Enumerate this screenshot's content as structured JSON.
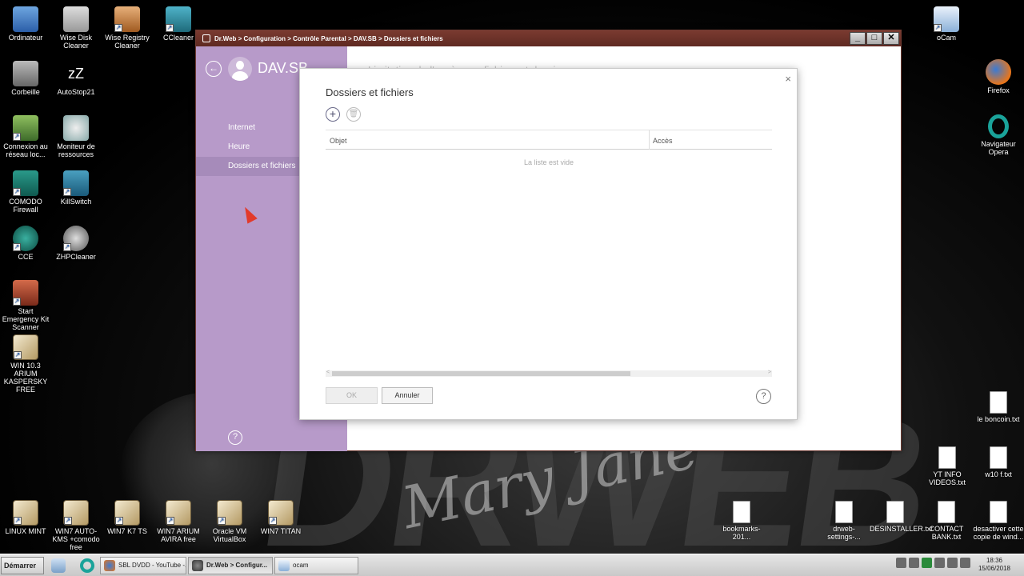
{
  "window": {
    "title": "Dr.Web > Configuration > Contrôle Parental > DAV.SB > Dossiers et fichiers",
    "minimize": "_",
    "maximize": "□",
    "close": "✕"
  },
  "sidebar": {
    "back": "←",
    "user": "DAV.SB",
    "items": [
      {
        "label": "Internet"
      },
      {
        "label": "Heure"
      },
      {
        "label": "Dossiers et fichiers"
      }
    ],
    "help": "?"
  },
  "main": {
    "heading": "Limitation de l'accès aux fichiers et dossiers"
  },
  "dialog": {
    "title": "Dossiers et fichiers",
    "close": "×",
    "add": "+",
    "delete": "🗑",
    "columns": {
      "object": "Objet",
      "access": "Accès"
    },
    "empty_text": "La liste est vide",
    "scroll_left": "<",
    "scroll_right": ">",
    "ok": "OK",
    "cancel": "Annuler",
    "help": "?"
  },
  "desktop_icons_left": [
    {
      "label": "Ordinateur",
      "icon": "computer-icon"
    },
    {
      "label": "Wise Disk Cleaner",
      "icon": "broom-icon"
    },
    {
      "label": "Wise Registry Cleaner",
      "icon": "registry-icon"
    },
    {
      "label": "CCleaner",
      "icon": "ccleaner-icon"
    },
    {
      "label": "Corbeille",
      "icon": "trash-icon"
    },
    {
      "label": "AutoStop21",
      "icon": "sleep-icon"
    },
    {
      "label": "Connexion au réseau loc...",
      "icon": "network-icon"
    },
    {
      "label": "Moniteur de ressources",
      "icon": "gauge-icon"
    },
    {
      "label": "COMODO Firewall",
      "icon": "comodo-icon"
    },
    {
      "label": "KillSwitch",
      "icon": "killswitch-icon"
    },
    {
      "label": "CCE",
      "icon": "cce-icon"
    },
    {
      "label": "ZHPCleaner",
      "icon": "zhp-icon"
    },
    {
      "label": "Start Emergency Kit Scanner",
      "icon": "scanner-icon"
    },
    {
      "label": "WIN 10.3 ARIUM KASPERSKY FREE",
      "icon": "vm-box-icon"
    }
  ],
  "desktop_icons_bottom": [
    {
      "label": "LINUX MINT"
    },
    {
      "label": "WIN7 AUTO-KMS +comodo free"
    },
    {
      "label": "WIN7 K7 TS"
    },
    {
      "label": "WIN7 ARIUM AVIRA free"
    },
    {
      "label": "Oracle VM VirtualBox"
    },
    {
      "label": "WIN7 TITAN"
    }
  ],
  "desktop_icons_right": [
    {
      "label": "oCam"
    },
    {
      "label": "Firefox"
    },
    {
      "label": "Navigateur Opera"
    },
    {
      "label": "le boncoin.txt"
    },
    {
      "label": "YT INFO VIDEOS.txt"
    },
    {
      "label": "w10 f.txt"
    },
    {
      "label": "bookmarks-201..."
    },
    {
      "label": "drweb-settings-..."
    },
    {
      "label": "DESINSTALLER.txt"
    },
    {
      "label": "CONTACT BANK.txt"
    },
    {
      "label": "desactiver cette copie de wind..."
    }
  ],
  "taskbar": {
    "start": "Démarrer",
    "tasks": [
      {
        "label": "SBL DVDD - YouTube -..."
      },
      {
        "label": "Dr.Web > Configur..."
      },
      {
        "label": "ocam"
      }
    ],
    "time": "18:36",
    "date": "15/06/2018"
  },
  "wallpaper": {
    "brand": "DRWEB",
    "script": "Mary Jane"
  },
  "colors": {
    "titlebar": "#6b2f27",
    "sidebar": "#b79ac9",
    "active_item": "#a68bba"
  }
}
